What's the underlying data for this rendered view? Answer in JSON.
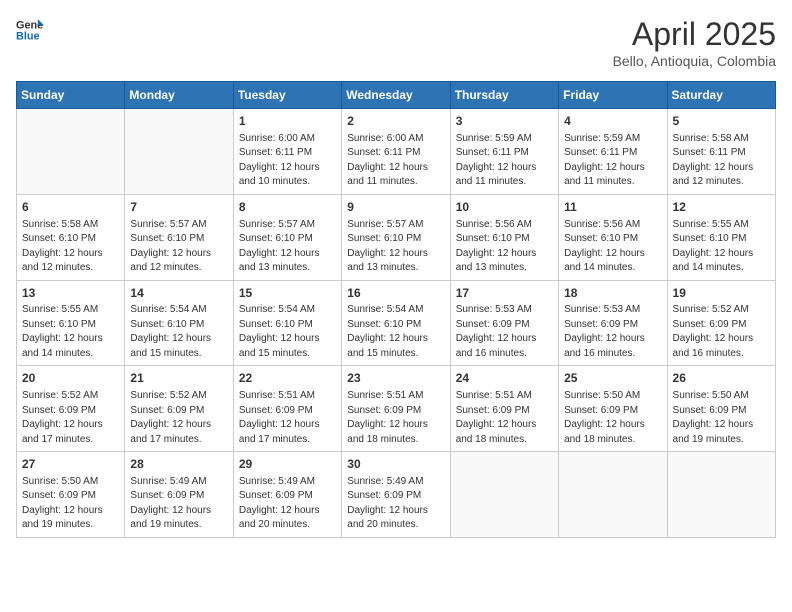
{
  "header": {
    "logo_line1": "General",
    "logo_line2": "Blue",
    "month_year": "April 2025",
    "location": "Bello, Antioquia, Colombia"
  },
  "days_of_week": [
    "Sunday",
    "Monday",
    "Tuesday",
    "Wednesday",
    "Thursday",
    "Friday",
    "Saturday"
  ],
  "weeks": [
    [
      {
        "day": "",
        "info": ""
      },
      {
        "day": "",
        "info": ""
      },
      {
        "day": "1",
        "info": "Sunrise: 6:00 AM\nSunset: 6:11 PM\nDaylight: 12 hours\nand 10 minutes."
      },
      {
        "day": "2",
        "info": "Sunrise: 6:00 AM\nSunset: 6:11 PM\nDaylight: 12 hours\nand 11 minutes."
      },
      {
        "day": "3",
        "info": "Sunrise: 5:59 AM\nSunset: 6:11 PM\nDaylight: 12 hours\nand 11 minutes."
      },
      {
        "day": "4",
        "info": "Sunrise: 5:59 AM\nSunset: 6:11 PM\nDaylight: 12 hours\nand 11 minutes."
      },
      {
        "day": "5",
        "info": "Sunrise: 5:58 AM\nSunset: 6:11 PM\nDaylight: 12 hours\nand 12 minutes."
      }
    ],
    [
      {
        "day": "6",
        "info": "Sunrise: 5:58 AM\nSunset: 6:10 PM\nDaylight: 12 hours\nand 12 minutes."
      },
      {
        "day": "7",
        "info": "Sunrise: 5:57 AM\nSunset: 6:10 PM\nDaylight: 12 hours\nand 12 minutes."
      },
      {
        "day": "8",
        "info": "Sunrise: 5:57 AM\nSunset: 6:10 PM\nDaylight: 12 hours\nand 13 minutes."
      },
      {
        "day": "9",
        "info": "Sunrise: 5:57 AM\nSunset: 6:10 PM\nDaylight: 12 hours\nand 13 minutes."
      },
      {
        "day": "10",
        "info": "Sunrise: 5:56 AM\nSunset: 6:10 PM\nDaylight: 12 hours\nand 13 minutes."
      },
      {
        "day": "11",
        "info": "Sunrise: 5:56 AM\nSunset: 6:10 PM\nDaylight: 12 hours\nand 14 minutes."
      },
      {
        "day": "12",
        "info": "Sunrise: 5:55 AM\nSunset: 6:10 PM\nDaylight: 12 hours\nand 14 minutes."
      }
    ],
    [
      {
        "day": "13",
        "info": "Sunrise: 5:55 AM\nSunset: 6:10 PM\nDaylight: 12 hours\nand 14 minutes."
      },
      {
        "day": "14",
        "info": "Sunrise: 5:54 AM\nSunset: 6:10 PM\nDaylight: 12 hours\nand 15 minutes."
      },
      {
        "day": "15",
        "info": "Sunrise: 5:54 AM\nSunset: 6:10 PM\nDaylight: 12 hours\nand 15 minutes."
      },
      {
        "day": "16",
        "info": "Sunrise: 5:54 AM\nSunset: 6:10 PM\nDaylight: 12 hours\nand 15 minutes."
      },
      {
        "day": "17",
        "info": "Sunrise: 5:53 AM\nSunset: 6:09 PM\nDaylight: 12 hours\nand 16 minutes."
      },
      {
        "day": "18",
        "info": "Sunrise: 5:53 AM\nSunset: 6:09 PM\nDaylight: 12 hours\nand 16 minutes."
      },
      {
        "day": "19",
        "info": "Sunrise: 5:52 AM\nSunset: 6:09 PM\nDaylight: 12 hours\nand 16 minutes."
      }
    ],
    [
      {
        "day": "20",
        "info": "Sunrise: 5:52 AM\nSunset: 6:09 PM\nDaylight: 12 hours\nand 17 minutes."
      },
      {
        "day": "21",
        "info": "Sunrise: 5:52 AM\nSunset: 6:09 PM\nDaylight: 12 hours\nand 17 minutes."
      },
      {
        "day": "22",
        "info": "Sunrise: 5:51 AM\nSunset: 6:09 PM\nDaylight: 12 hours\nand 17 minutes."
      },
      {
        "day": "23",
        "info": "Sunrise: 5:51 AM\nSunset: 6:09 PM\nDaylight: 12 hours\nand 18 minutes."
      },
      {
        "day": "24",
        "info": "Sunrise: 5:51 AM\nSunset: 6:09 PM\nDaylight: 12 hours\nand 18 minutes."
      },
      {
        "day": "25",
        "info": "Sunrise: 5:50 AM\nSunset: 6:09 PM\nDaylight: 12 hours\nand 18 minutes."
      },
      {
        "day": "26",
        "info": "Sunrise: 5:50 AM\nSunset: 6:09 PM\nDaylight: 12 hours\nand 19 minutes."
      }
    ],
    [
      {
        "day": "27",
        "info": "Sunrise: 5:50 AM\nSunset: 6:09 PM\nDaylight: 12 hours\nand 19 minutes."
      },
      {
        "day": "28",
        "info": "Sunrise: 5:49 AM\nSunset: 6:09 PM\nDaylight: 12 hours\nand 19 minutes."
      },
      {
        "day": "29",
        "info": "Sunrise: 5:49 AM\nSunset: 6:09 PM\nDaylight: 12 hours\nand 20 minutes."
      },
      {
        "day": "30",
        "info": "Sunrise: 5:49 AM\nSunset: 6:09 PM\nDaylight: 12 hours\nand 20 minutes."
      },
      {
        "day": "",
        "info": ""
      },
      {
        "day": "",
        "info": ""
      },
      {
        "day": "",
        "info": ""
      }
    ]
  ]
}
